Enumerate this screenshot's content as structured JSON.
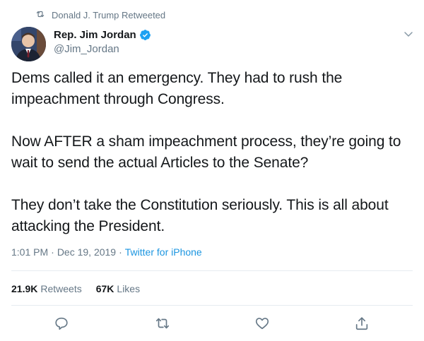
{
  "retweet_context": {
    "text": "Donald J. Trump Retweeted",
    "icon": "retweet-icon"
  },
  "author": {
    "display_name": "Rep. Jim Jordan",
    "handle": "@Jim_Jordan",
    "verified": true,
    "verified_color": "#1da1f2"
  },
  "tweet": {
    "text": "Dems called it an emergency. They had to rush the impeachment through Congress.\n\nNow AFTER a sham impeachment process, they’re going to wait to send the actual Articles to the Senate?\n\nThey don’t take the Constitution seriously. This is all about attacking the President.",
    "time": "1:01 PM",
    "separator": "·",
    "date": "Dec 19, 2019",
    "source": "Twitter for iPhone"
  },
  "stats": {
    "retweets_count": "21.9K",
    "retweets_label": "Retweets",
    "likes_count": "67K",
    "likes_label": "Likes"
  },
  "actions": [
    {
      "name": "reply",
      "icon": "reply-icon"
    },
    {
      "name": "retweet",
      "icon": "retweet-icon"
    },
    {
      "name": "like",
      "icon": "heart-icon"
    },
    {
      "name": "share",
      "icon": "share-icon"
    }
  ],
  "colors": {
    "link": "#1b95e0",
    "secondary_text": "#657786",
    "primary_text": "#14171a",
    "divider": "#e6ecf0"
  }
}
